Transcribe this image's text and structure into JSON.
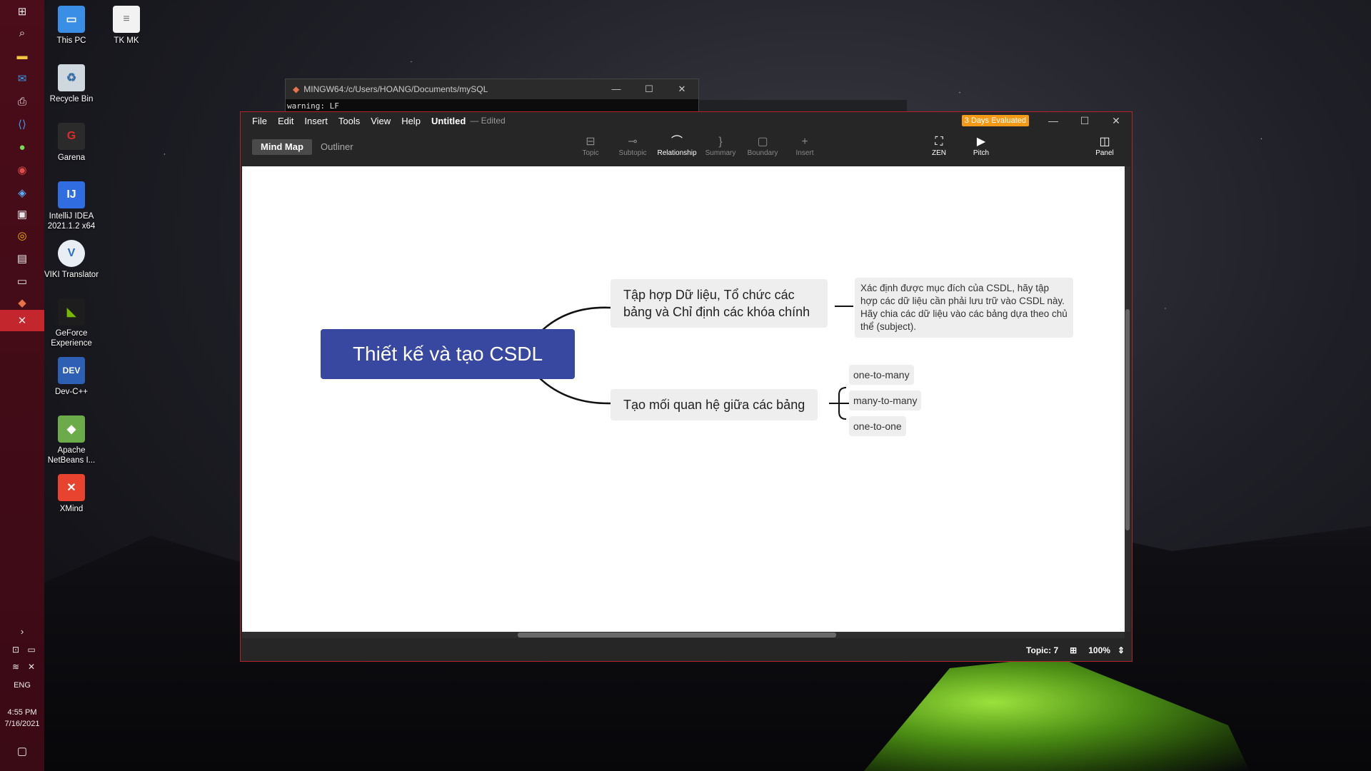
{
  "taskbar": {
    "language": "ENG",
    "time": "4:55 PM",
    "date": "7/16/2021"
  },
  "desktop": {
    "icons": [
      {
        "label": "This PC"
      },
      {
        "label": "TK MK"
      },
      {
        "label": "Recycle Bin"
      },
      {
        "label": "Garena"
      },
      {
        "label": "IntelliJ IDEA 2021.1.2 x64"
      },
      {
        "label": "VIKI Translator"
      },
      {
        "label": "GeForce Experience"
      },
      {
        "label": "Dev-C++"
      },
      {
        "label": "Apache NetBeans I..."
      },
      {
        "label": "XMind"
      }
    ]
  },
  "terminal": {
    "title": "MINGW64:/c/Users/HOANG/Documents/mySQL",
    "line": "warning: LF"
  },
  "xmind": {
    "menu": [
      "File",
      "Edit",
      "Insert",
      "Tools",
      "View",
      "Help"
    ],
    "doc_title": "Untitled",
    "edited_label": "— Edited",
    "eval_badge": "3 Days Evaluated",
    "view_tabs": {
      "mindmap": "Mind Map",
      "outliner": "Outliner"
    },
    "tools": {
      "topic": "Topic",
      "subtopic": "Subtopic",
      "relationship": "Relationship",
      "summary": "Summary",
      "boundary": "Boundary",
      "insert": "Insert",
      "zen": "ZEN",
      "pitch": "Pitch",
      "panel": "Panel"
    },
    "status": {
      "topic_count": "Topic: 7",
      "zoom": "100%"
    },
    "map": {
      "central": "Thiết kế và tạo CSDL",
      "topic1": "Tập hợp Dữ liệu, Tổ chức các bảng và Chỉ định các khóa chính",
      "note1": "Xác định được mục đích của CSDL, hãy tập hợp các dữ liệu cần phải lưu trữ vào CSDL này. Hãy chia các dữ liệu vào các bảng dựa theo chủ thể (subject).",
      "topic2": "Tạo mối quan hệ giữa các bảng",
      "sub1": "one-to-many",
      "sub2": "many-to-many",
      "sub3": "one-to-one"
    }
  }
}
